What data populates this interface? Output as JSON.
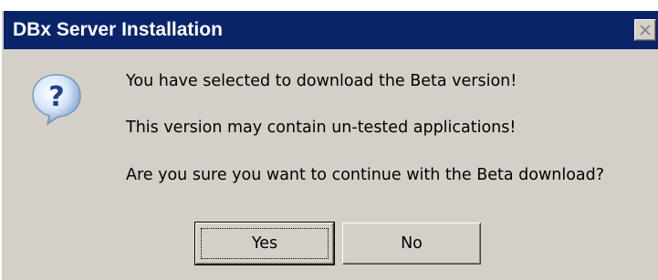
{
  "window": {
    "title": "DBx Server Installation",
    "close_icon": "close-icon"
  },
  "message": {
    "icon": "question-icon",
    "lines": [
      "You have selected to download the Beta version!",
      "This version may contain un-tested applications!",
      "Are you sure you want to continue with the Beta download?"
    ]
  },
  "buttons": {
    "yes_label": "Yes",
    "no_label": "No"
  },
  "colors": {
    "titlebar": "#0a246a",
    "dialog_bg": "#d4d0c8"
  }
}
